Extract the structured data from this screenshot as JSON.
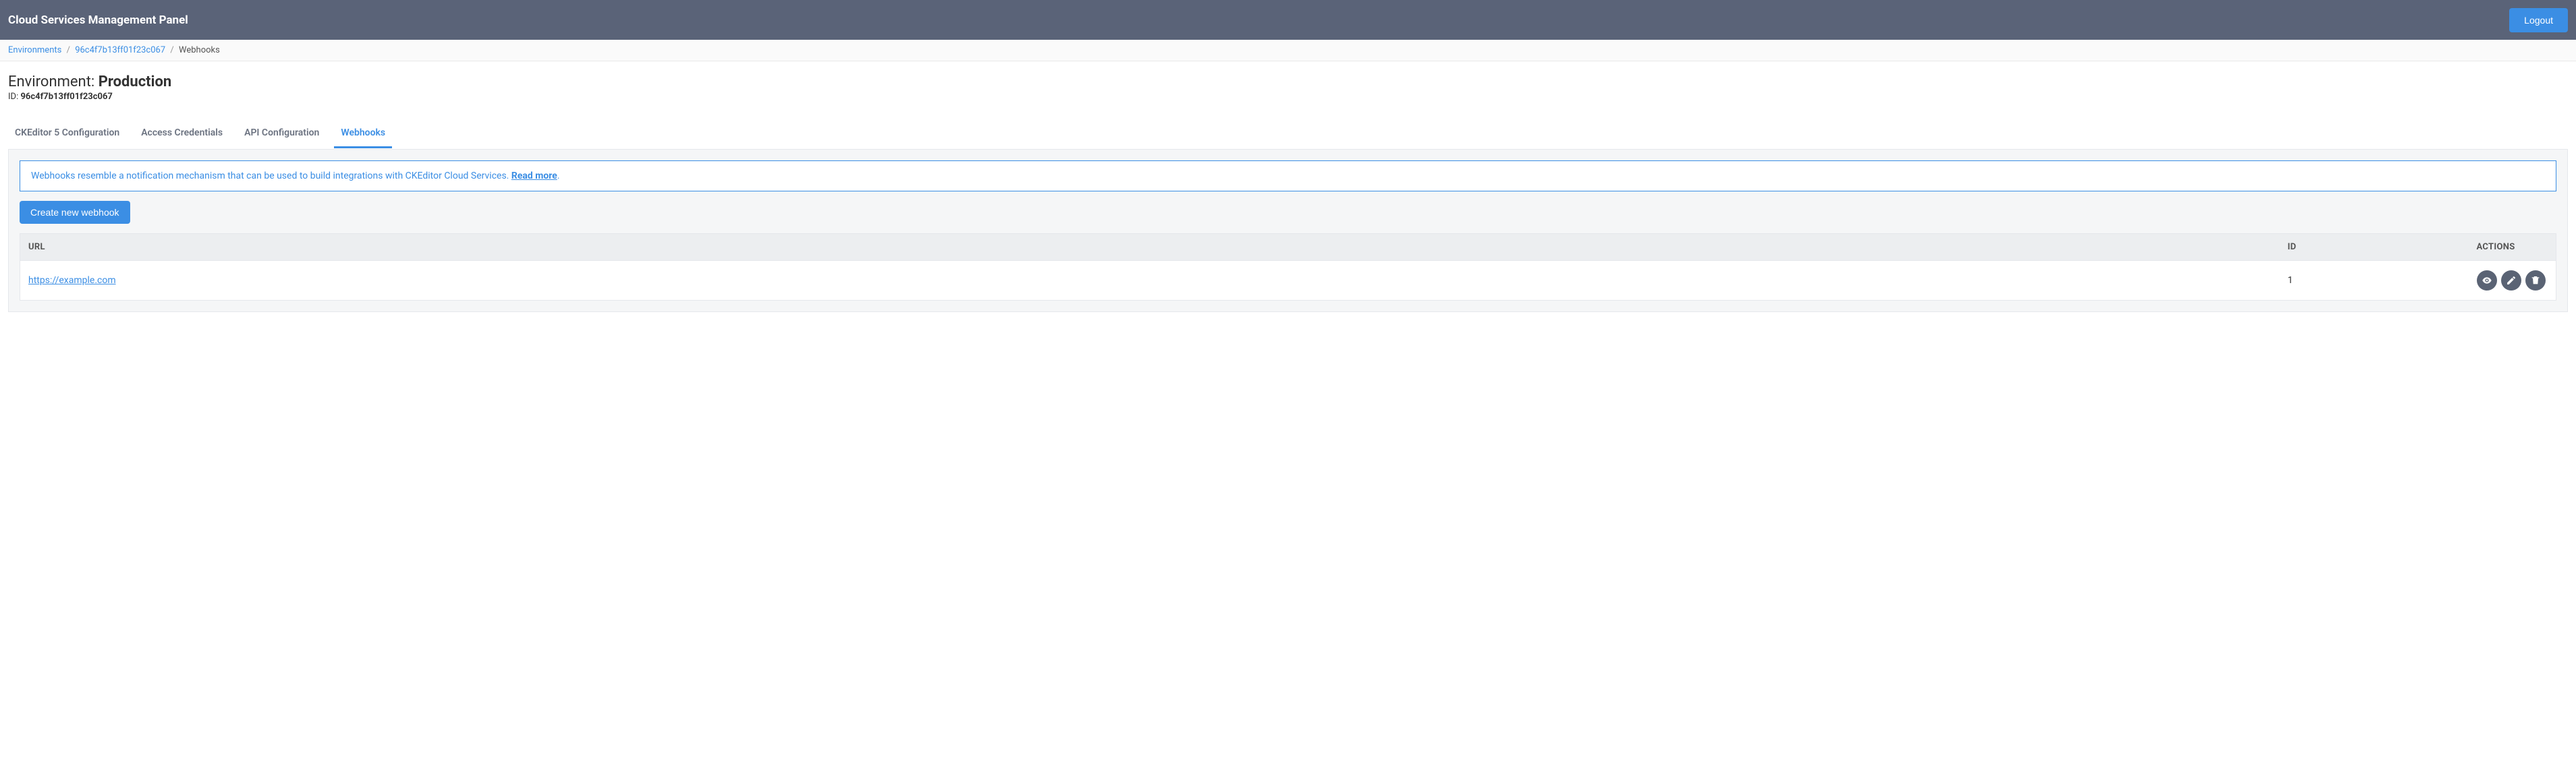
{
  "topbar": {
    "title": "Cloud Services Management Panel",
    "logout": "Logout"
  },
  "breadcrumb": {
    "environments": "Environments",
    "env_id_link": "96c4f7b13ff01f23c067",
    "current": "Webhooks"
  },
  "header": {
    "env_label": "Environment: ",
    "env_name": "Production",
    "id_label": "ID: ",
    "env_id": "96c4f7b13ff01f23c067"
  },
  "tabs": {
    "ckeditor": "CKEditor 5 Configuration",
    "access": "Access Credentials",
    "api": "API Configuration",
    "webhooks": "Webhooks"
  },
  "info": {
    "text": "Webhooks resemble a notification mechanism that can be used to build integrations with CKEditor Cloud Services. ",
    "read_more": "Read more",
    "period": "."
  },
  "buttons": {
    "create": "Create new webhook"
  },
  "table": {
    "headers": {
      "url": "URL",
      "id": "ID",
      "actions": "ACTIONS"
    },
    "rows": [
      {
        "url": "https://example.com",
        "id": "1"
      }
    ]
  }
}
